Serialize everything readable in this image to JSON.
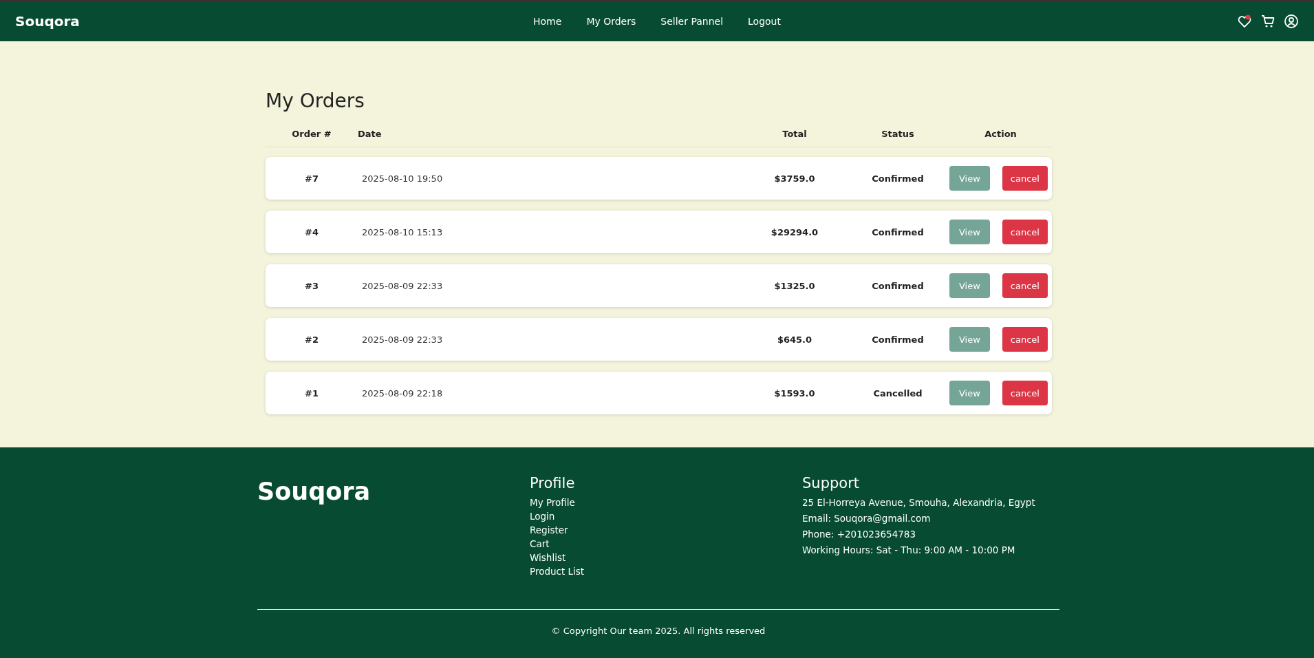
{
  "navbar": {
    "brand": "Souqora",
    "links": [
      {
        "label": "Home"
      },
      {
        "label": "My Orders"
      },
      {
        "label": "Seller Pannel"
      },
      {
        "label": "Logout"
      }
    ]
  },
  "page": {
    "title": "My Orders"
  },
  "table": {
    "columns": [
      "Order #",
      "Date",
      "Total",
      "Status",
      "Action"
    ],
    "rows": [
      {
        "order": "#7",
        "date": "2025-08-10 19:50",
        "total": "$3759.0",
        "status": "Confirmed",
        "actions": [
          "View",
          "cancel"
        ]
      },
      {
        "order": "#4",
        "date": "2025-08-10 15:13",
        "total": "$29294.0",
        "status": "Confirmed",
        "actions": [
          "View",
          "cancel"
        ]
      },
      {
        "order": "#3",
        "date": "2025-08-09 22:33",
        "total": "$1325.0",
        "status": "Confirmed",
        "actions": [
          "View",
          "cancel"
        ]
      },
      {
        "order": "#2",
        "date": "2025-08-09 22:33",
        "total": "$645.0",
        "status": "Confirmed",
        "actions": [
          "View",
          "cancel"
        ]
      },
      {
        "order": "#1",
        "date": "2025-08-09 22:18",
        "total": "$1593.0",
        "status": "Cancelled",
        "actions": [
          "View",
          "cancel"
        ]
      }
    ]
  },
  "footer": {
    "brand": "Souqora",
    "profile": {
      "heading": "Profile",
      "links": [
        "My Profile",
        "Login",
        "Register",
        "Cart",
        "Wishlist",
        "Product List"
      ]
    },
    "support": {
      "heading": "Support",
      "lines": [
        "25 El-Horreya Avenue, Smouha, Alexandria, Egypt",
        "Email: Souqora@gmail.com",
        "Phone: +201023654783",
        "Working Hours: Sat - Thu: 9:00 AM - 10:00 PM"
      ]
    },
    "copyright": "© Copyright Our team 2025. All rights reserved"
  }
}
